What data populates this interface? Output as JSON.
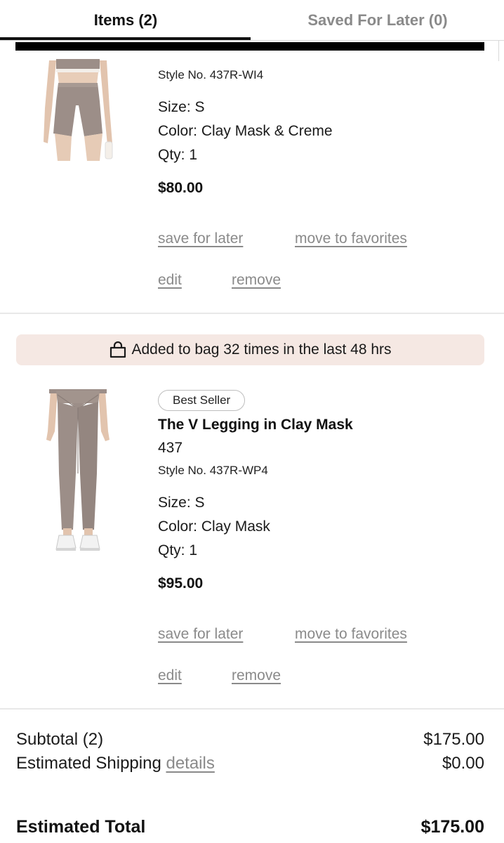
{
  "tabs": {
    "items_label": "Items (2)",
    "saved_label": "Saved For Later (0)"
  },
  "items": [
    {
      "image": "bike-shorts-product-photo",
      "style_no": "Style No. 437R-WI4",
      "size": "Size: S",
      "color": "Color: Clay Mask & Creme",
      "qty": "Qty: 1",
      "price": "$80.00",
      "actions": {
        "save_for_later": "save for later",
        "move_to_favorites": "move to favorites",
        "edit": "edit",
        "remove": "remove"
      }
    },
    {
      "image": "legging-product-photo",
      "promo": "Added to bag 32 times in the last 48 hrs",
      "badge": "Best Seller",
      "name": "The V Legging in Clay Mask",
      "brand": "437",
      "style_no": "Style No. 437R-WP4",
      "size": "Size: S",
      "color": "Color: Clay Mask",
      "qty": "Qty: 1",
      "price": "$95.00",
      "actions": {
        "save_for_later": "save for later",
        "move_to_favorites": "move to favorites",
        "edit": "edit",
        "remove": "remove"
      }
    }
  ],
  "summary": {
    "subtotal_label": "Subtotal (2)",
    "subtotal_value": "$175.00",
    "shipping_label": "Estimated Shipping",
    "shipping_link": "details",
    "shipping_value": "$0.00",
    "total_label": "Estimated Total",
    "total_value": "$175.00"
  },
  "colors": {
    "text": "#111111",
    "muted_link": "#8a8a8a",
    "promo_bg": "#f5e8e3",
    "product_fabric": "#9c8e88"
  },
  "icons": {
    "promo": "shopping-bag-icon"
  }
}
